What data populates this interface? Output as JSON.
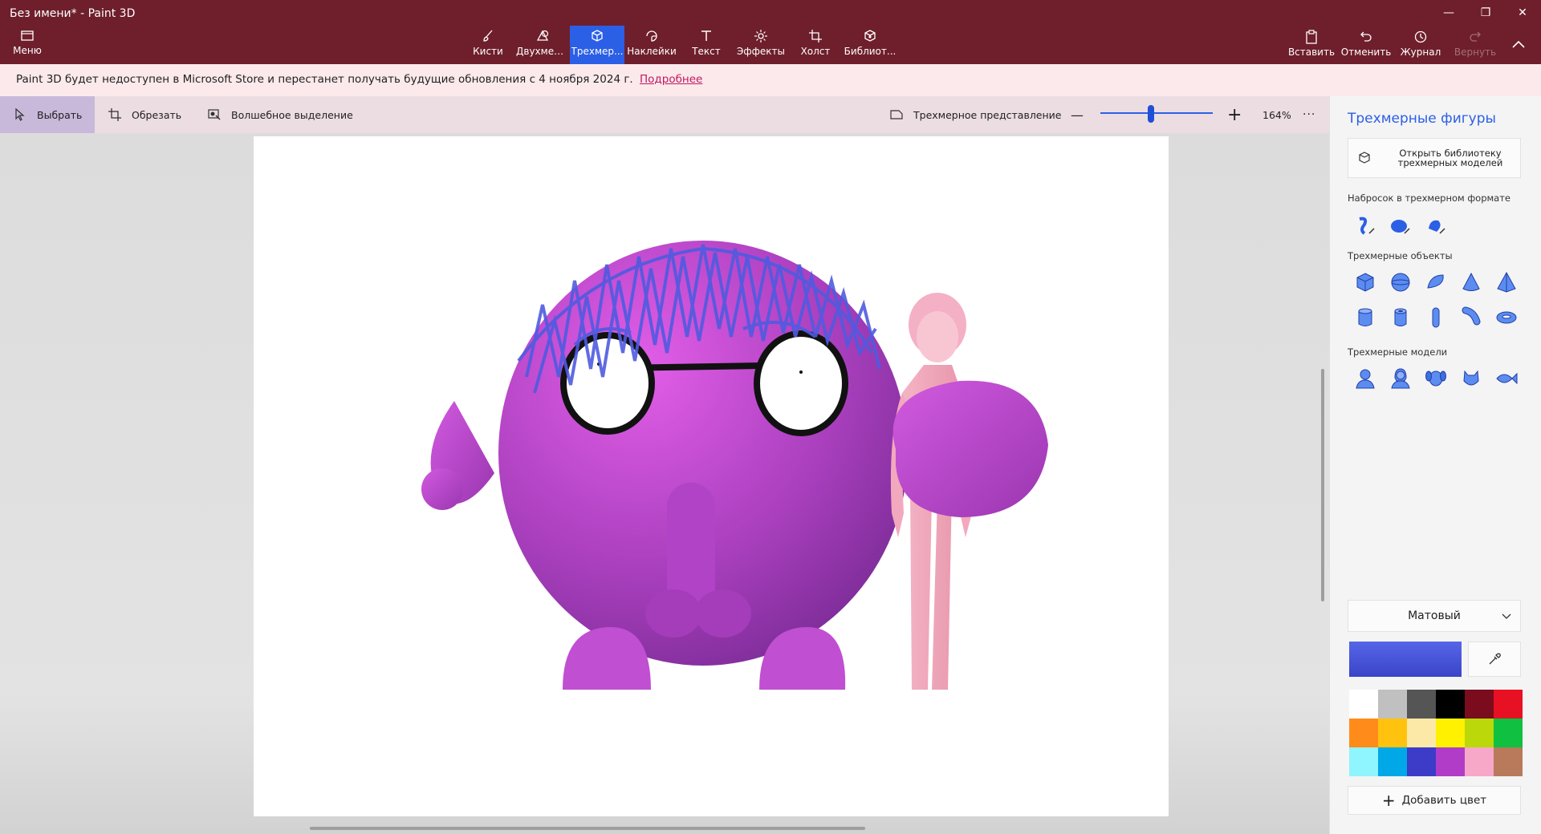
{
  "window": {
    "title": "Без имени* - Paint 3D",
    "minimize": "—",
    "restore": "❐",
    "close": "✕"
  },
  "menu": {
    "label": "Меню"
  },
  "ribbon": [
    {
      "label": "Кисти",
      "icon": "brush-icon"
    },
    {
      "label": "Двухмер...",
      "icon": "2d-shapes-icon"
    },
    {
      "label": "Трехмер...",
      "icon": "3d-shapes-icon",
      "active": true
    },
    {
      "label": "Наклейки",
      "icon": "stickers-icon"
    },
    {
      "label": "Текст",
      "icon": "text-icon"
    },
    {
      "label": "Эффекты",
      "icon": "effects-icon"
    },
    {
      "label": "Холст",
      "icon": "canvas-icon"
    },
    {
      "label": "Библиот...",
      "icon": "library-icon"
    }
  ],
  "actions": {
    "paste": "Вставить",
    "undo": "Отменить",
    "history": "Журнал",
    "redo": "Вернуть"
  },
  "notice": {
    "text": "Paint 3D будет недоступен в Microsoft Store и перестанет получать будущие обновления с 4 ноября 2024 г.",
    "link": "Подробнее"
  },
  "toolbar": {
    "select": "Выбрать",
    "crop": "Обрезать",
    "magic_select": "Волшебное выделение",
    "view3d": "Трехмерное представление",
    "zoom_minus": "—",
    "zoom_plus": "+",
    "zoom_value": "164%",
    "zoom_level": 0.45,
    "more": "···"
  },
  "panel": {
    "title": "Трехмерные фигуры",
    "open_library": "Открыть библиотеку\nтрехмерных моделей",
    "sketch_label": "Набросок в трехмерном формате",
    "objects_label": "Трехмерные объекты",
    "models_label": "Трехмерные модели",
    "sketch_tools": [
      "sharp-edge-doodle-icon",
      "soft-edge-doodle-icon",
      "tube-doodle-icon"
    ],
    "objects_row1": [
      "cube-icon",
      "sphere-icon",
      "hemisphere-icon",
      "cone-icon",
      "pyramid-icon"
    ],
    "objects_row2": [
      "cylinder-icon",
      "tube-icon",
      "capsule-icon",
      "curved-tube-icon",
      "donut-icon"
    ],
    "models": [
      "man-icon",
      "woman-icon",
      "dog-icon",
      "cat-icon",
      "fish-icon"
    ],
    "material": "Матовый",
    "current_color": "#3a44c8",
    "palette": [
      "#ffffff",
      "#c0c0c0",
      "#555555",
      "#000000",
      "#7a0c1e",
      "#e81123",
      "#ff8c1a",
      "#ffc20e",
      "#fce9a8",
      "#fff100",
      "#bad80a",
      "#10c040",
      "#8ff5ff",
      "#00a8e8",
      "#3c3cc8",
      "#b13cc8",
      "#f7a8c8",
      "#b87a5a"
    ],
    "add_color": "Добавить цвет"
  }
}
